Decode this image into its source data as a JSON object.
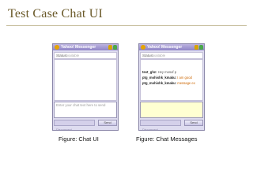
{
  "slide": {
    "title": "Test Case Chat UI"
  },
  "windows": [
    {
      "title": "Yahoo! Messenger",
      "status_label": "Status:",
      "status_value": "Available",
      "messages": [],
      "compose_placeholder": "Enter your chat text here to send",
      "bottom_left": "Disconnect",
      "send_label": "Send",
      "caption": "Figure: Chat UI"
    },
    {
      "title": "Yahoo! Messenger",
      "status_label": "Status:",
      "status_value": "Available",
      "messages": [
        {
          "sender": "test_ghz:",
          "text": "Hey mosuf p"
        },
        {
          "sender": "ptg_mohishk_kmaku:",
          "text": "I am good"
        },
        {
          "sender": "ptg_mohishk_kmaku:",
          "text": "message ex"
        }
      ],
      "compose_placeholder": "",
      "bottom_left": "Disconnect",
      "send_label": "Send",
      "caption": "Figure: Chat Messages"
    }
  ]
}
